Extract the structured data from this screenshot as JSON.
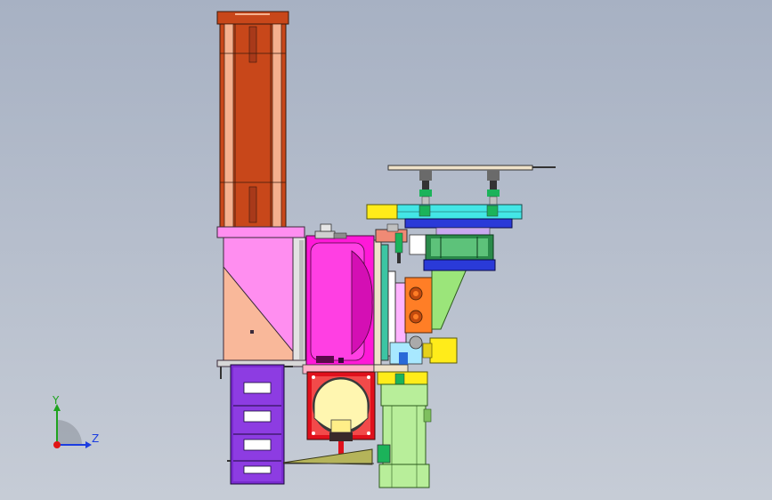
{
  "viewport": {
    "background_top": "#a7b1c3",
    "background_bottom": "#c6ccd6"
  },
  "triad": {
    "y_label": "Y",
    "z_label": "Z",
    "y_color": "#1fa31f",
    "z_color": "#1c3de0",
    "x_color": "#e01515"
  },
  "colors": {
    "column_orange": "#c8471a",
    "column_light": "#f5b08e",
    "housing_pink": "#ff8ef0",
    "housing_salmon": "#f9b89a",
    "magenta_motor": "#ff19d8",
    "purple_drum": "#7a2bd0",
    "red_base": "#e0101c",
    "cream_cap": "#fff6b0",
    "green_cylinder": "#b8ee9a",
    "cyan_rail": "#43e6e6",
    "blue_plate": "#2a3ad8",
    "yellow_part": "#ffec1a",
    "tan_plate": "#efe2c9",
    "orange_block": "#ff7e26",
    "grey_steel": "#8c8c8c",
    "teal_mount": "#3cc5a3"
  }
}
